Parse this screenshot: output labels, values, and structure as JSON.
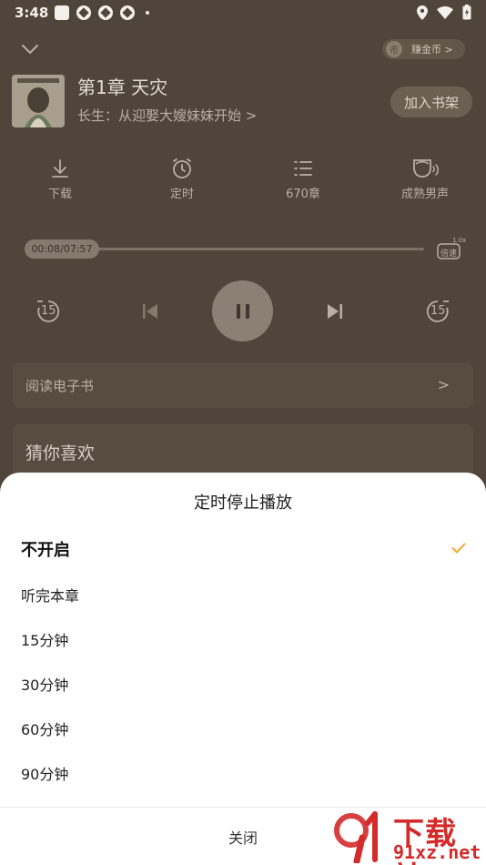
{
  "status_bar": {
    "time": "3:48"
  },
  "header": {
    "coin_label": "赚金币 >"
  },
  "book": {
    "chapter_title": "第1章 天灾",
    "book_link": "长生：从迎娶大嫂妹妹开始 >",
    "add_shelf_label": "加入书架"
  },
  "tools": [
    {
      "icon": "download-icon",
      "label": "下载"
    },
    {
      "icon": "alarm-clock-icon",
      "label": "定时"
    },
    {
      "icon": "chapter-list-icon",
      "label": "670章"
    },
    {
      "icon": "voice-icon",
      "label": "成熟男声"
    }
  ],
  "progress": {
    "time": "00:08/07:57",
    "speed_badge": "1.0x",
    "speed_label": "倍速",
    "fraction": 0.017
  },
  "controls": {
    "rewind_seconds": "15",
    "forward_seconds": "15"
  },
  "read_ebook": {
    "label": "阅读电子书",
    "arrow": ">"
  },
  "recommend": {
    "label": "猜你喜欢"
  },
  "timer_sheet": {
    "title": "定时停止播放",
    "options": [
      {
        "label": "不开启",
        "selected": true
      },
      {
        "label": "听完本章",
        "selected": false
      },
      {
        "label": "15分钟",
        "selected": false
      },
      {
        "label": "30分钟",
        "selected": false
      },
      {
        "label": "60分钟",
        "selected": false
      },
      {
        "label": "90分钟",
        "selected": false
      }
    ],
    "close_label": "关闭"
  },
  "watermark": {
    "big_text": "下载站",
    "small_text": "91xz.net"
  },
  "colors": {
    "accent_orange": "#f5a623",
    "sheet_bg": "#ffffff",
    "player_bg": "#50453b",
    "watermark_red": "#d42a2a"
  }
}
